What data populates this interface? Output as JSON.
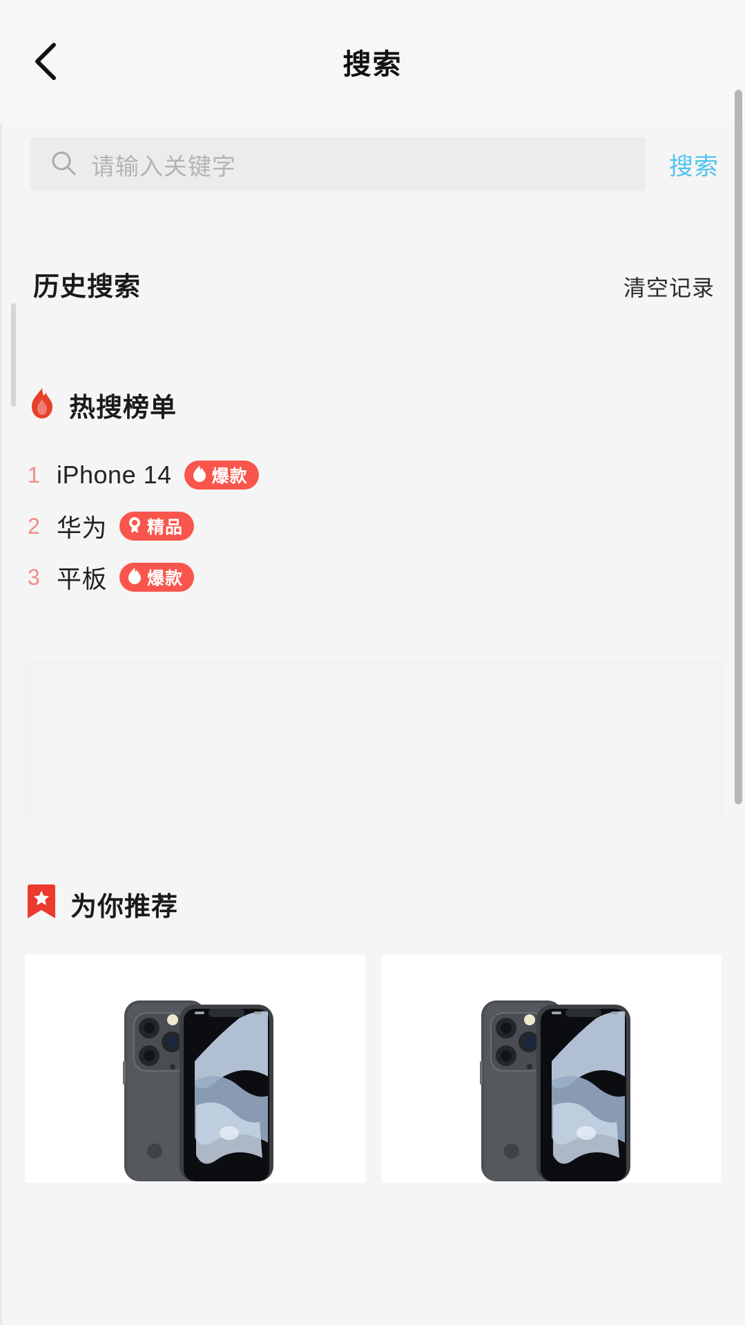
{
  "header": {
    "title": "搜索",
    "back_icon": "chevron-left-icon"
  },
  "search": {
    "icon": "search-icon",
    "placeholder": "请输入关键字",
    "value": "",
    "submit_label": "搜索",
    "submit_color": "#4ec4ee"
  },
  "history": {
    "title": "历史搜索",
    "clear_label": "清空记录",
    "items": []
  },
  "hot": {
    "icon": "flame-icon",
    "title": "热搜榜单",
    "items": [
      {
        "rank": "1",
        "keyword": "iPhone 14",
        "badge_text": "爆款",
        "badge_icon": "flame-icon",
        "badge_color": "#f8564c"
      },
      {
        "rank": "2",
        "keyword": "华为",
        "badge_text": "精品",
        "badge_icon": "medal-icon",
        "badge_color": "#f8564c"
      },
      {
        "rank": "3",
        "keyword": "平板",
        "badge_text": "爆款",
        "badge_icon": "flame-icon",
        "badge_color": "#f8564c"
      }
    ]
  },
  "recommend": {
    "icon": "bookmark-star-icon",
    "title": "为你推荐",
    "cards": [
      {
        "image_alt": "iphone-product-image"
      },
      {
        "image_alt": "iphone-product-image"
      }
    ]
  },
  "colors": {
    "page_bg": "#f5f5f5",
    "accent_red": "#f8564c",
    "accent_blue": "#4ec4ee",
    "rank_pink": "#f08c85"
  }
}
